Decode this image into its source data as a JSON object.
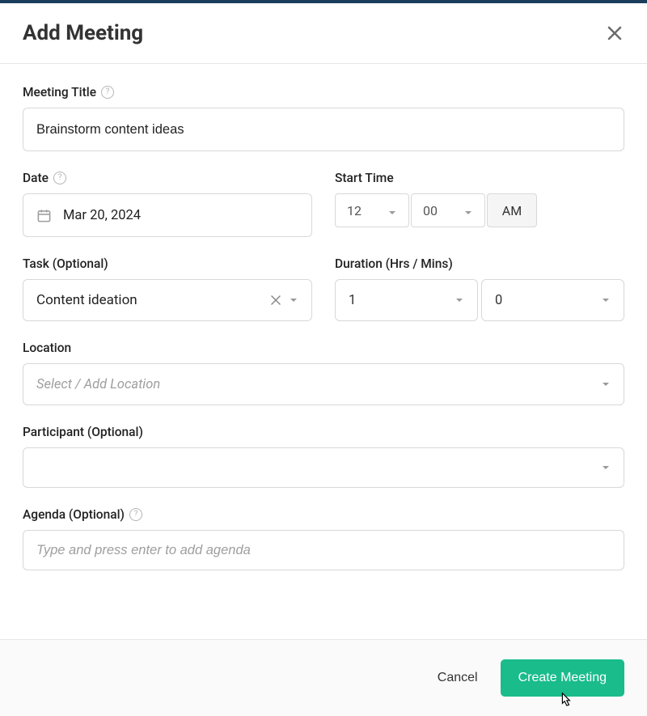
{
  "modal": {
    "title": "Add Meeting"
  },
  "fields": {
    "meetingTitle": {
      "label": "Meeting Title",
      "value": "Brainstorm content ideas"
    },
    "date": {
      "label": "Date",
      "value": "Mar 20, 2024"
    },
    "startTime": {
      "label": "Start Time",
      "hour": "12",
      "minute": "00",
      "ampm": "AM"
    },
    "task": {
      "label": "Task (Optional)",
      "value": "Content ideation"
    },
    "duration": {
      "label": "Duration (Hrs / Mins)",
      "hrs": "1",
      "mins": "0"
    },
    "location": {
      "label": "Location",
      "placeholder": "Select / Add Location"
    },
    "participant": {
      "label": "Participant (Optional)"
    },
    "agenda": {
      "label": "Agenda (Optional)",
      "placeholder": "Type and press enter to add agenda"
    }
  },
  "footer": {
    "cancel": "Cancel",
    "create": "Create Meeting"
  }
}
